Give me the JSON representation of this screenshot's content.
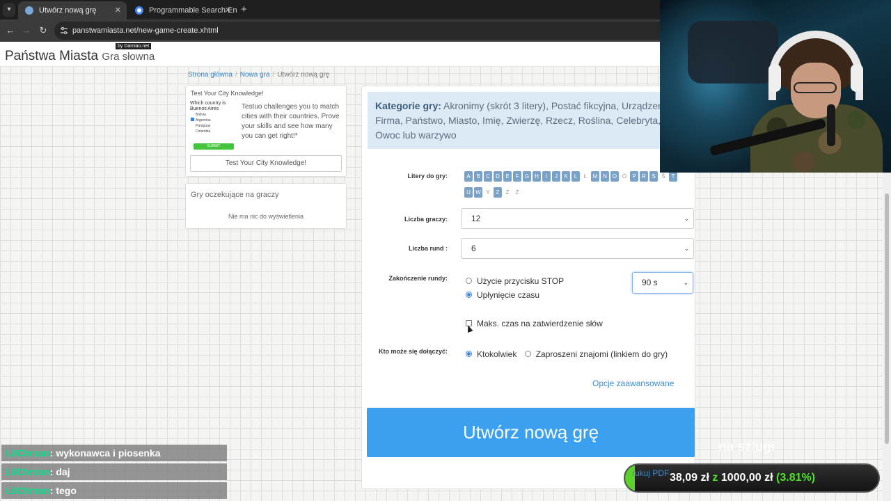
{
  "browser": {
    "tabs": [
      {
        "label": "Utwórz nową grę",
        "active": true
      },
      {
        "label": "Programmable Search Engine",
        "active": false
      }
    ],
    "new_tab": "+",
    "menu_icon": "chevron-down-icon",
    "url": "panstwamiasta.net/new-game-create.xhtml"
  },
  "site": {
    "logo": "Państwa Miasta",
    "logo_sub": "Gra słowna",
    "byline": "by Damiao.net"
  },
  "breadcrumb": [
    "Strona główna",
    "Nowa gra",
    "Utwórz nową grę"
  ],
  "ad": {
    "title": "Test Your City Knowledge!",
    "quiz_question": "Which country is Buenos Aires",
    "quiz_options": [
      "Bolivia",
      "Argentina",
      "Paraguay",
      "Colombia"
    ],
    "quiz_button": "SUBMIT",
    "text": "Testuo challenges you to match cities with their countries. Prove your skills and see how many you can get right!*",
    "button": "Test Your City Knowledge!"
  },
  "waiting": {
    "title": "Gry oczekujące na graczy",
    "empty": "Nie ma nic do wyświetlenia"
  },
  "categories": {
    "label": "Kategorie gry:",
    "text": "Akronimy (skrót 3 litery), Postać fikcyjna, Urządzen Firma, Państwo, Miasto, Imię, Zwierzę, Rzecz, Roślina, Celebryta, Owoc lub warzywo"
  },
  "form": {
    "letters_label": "Litery do gry:",
    "letters": [
      {
        "l": "A",
        "on": true
      },
      {
        "l": "B",
        "on": true
      },
      {
        "l": "C",
        "on": true
      },
      {
        "l": "D",
        "on": true
      },
      {
        "l": "E",
        "on": true
      },
      {
        "l": "F",
        "on": true
      },
      {
        "l": "G",
        "on": true
      },
      {
        "l": "H",
        "on": true
      },
      {
        "l": "I",
        "on": true
      },
      {
        "l": "J",
        "on": true
      },
      {
        "l": "K",
        "on": true
      },
      {
        "l": "L",
        "on": true
      },
      {
        "l": "Ł",
        "on": false
      },
      {
        "l": "M",
        "on": true
      },
      {
        "l": "N",
        "on": true
      },
      {
        "l": "O",
        "on": true
      },
      {
        "l": "Ó",
        "on": false
      },
      {
        "l": "P",
        "on": true
      },
      {
        "l": "R",
        "on": true
      },
      {
        "l": "S",
        "on": true
      },
      {
        "l": "Ś",
        "on": false
      },
      {
        "l": "T",
        "on": true
      },
      {
        "l": "U",
        "on": true
      },
      {
        "l": "W",
        "on": true
      },
      {
        "l": "Y",
        "on": false
      },
      {
        "l": "Z",
        "on": true
      },
      {
        "l": "Ź",
        "on": false
      },
      {
        "l": "Ż",
        "on": false
      }
    ],
    "players_label": "Liczba graczy:",
    "players_value": "12",
    "rounds_label": "Liczba rund :",
    "rounds_value": "6",
    "end_label": "Zakończenie rundy:",
    "end_stop": "Użycie przycisku STOP",
    "end_time": "Upłynięcie czasu",
    "time_value": "90 s",
    "max_time": "Maks. czas na zatwierdzenie słów",
    "join_label": "Kto może się dołączyć:",
    "join_anyone": "Ktokolwiek",
    "join_invited": "Zaproszeni znajomi (linkiem do gry)",
    "advanced": "Opcje zaawansowane",
    "create": "Utwórz nową grę",
    "caret": "⌄"
  },
  "chat": [
    {
      "user": "LilChrzan",
      "msg": ": wykonawca i piosenka"
    },
    {
      "user": "LilChrzan",
      "msg": ": daj"
    },
    {
      "user": "LilChrzan",
      "msg": ": tego"
    }
  ],
  "overlay": {
    "caption": "na szlugi",
    "pdf_peek": "rukuj PDF",
    "donation_current": "38,09 zł",
    "donation_z": "z",
    "donation_goal": "1000,00 zł",
    "donation_percent": "(3.81%)",
    "donation_fraction": 0.0381
  }
}
